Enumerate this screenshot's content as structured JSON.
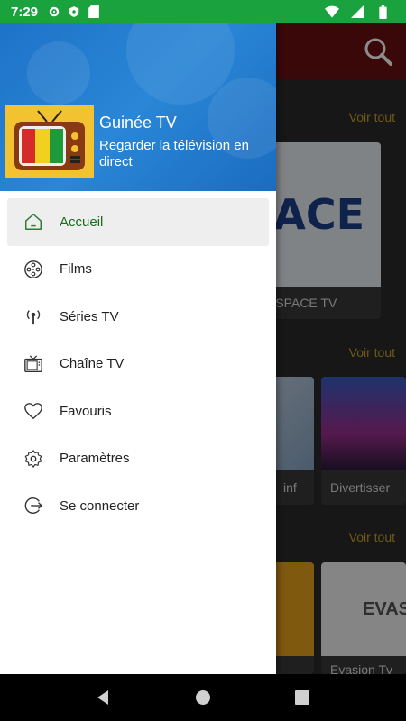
{
  "status_bar": {
    "time": "7:29",
    "left_icons": [
      "gear-icon",
      "shield-icon",
      "sd-card-icon"
    ],
    "right_icons": [
      "wifi-icon",
      "signal-icon",
      "battery-icon"
    ]
  },
  "drawer": {
    "app_title": "Guinée TV",
    "app_subtitle": "Regarder la télévision en direct",
    "items": [
      {
        "label": "Accueil",
        "icon": "home-icon",
        "active": true
      },
      {
        "label": "Films",
        "icon": "film-reel-icon",
        "active": false
      },
      {
        "label": "Séries TV",
        "icon": "broadcast-icon",
        "active": false
      },
      {
        "label": "Chaîne TV",
        "icon": "tv-icon",
        "active": false
      },
      {
        "label": "Favouris",
        "icon": "heart-icon",
        "active": false
      },
      {
        "label": "Paramètres",
        "icon": "gear-icon",
        "active": false
      },
      {
        "label": "Se connecter",
        "icon": "login-icon",
        "active": false
      }
    ]
  },
  "background": {
    "see_all_labels": [
      "Voir tout",
      "Voir tout",
      "Voir tout"
    ],
    "cards": [
      {
        "caption": "ESPACE TV",
        "thumb_text": "ESPACE"
      },
      {
        "caption": "inf"
      },
      {
        "caption": "Divertisser"
      },
      {
        "caption": "Evasion Tv",
        "thumb_text": "EVAS"
      }
    ]
  },
  "colors": {
    "status_bar": "#1aa23f",
    "drawer_header": "#1e73c8",
    "active_item_text": "#1b6b1b",
    "see_all": "#c9a227",
    "toolbar": "#6b0f12"
  },
  "nav_bar": [
    "back-icon",
    "home-icon",
    "recents-icon"
  ]
}
